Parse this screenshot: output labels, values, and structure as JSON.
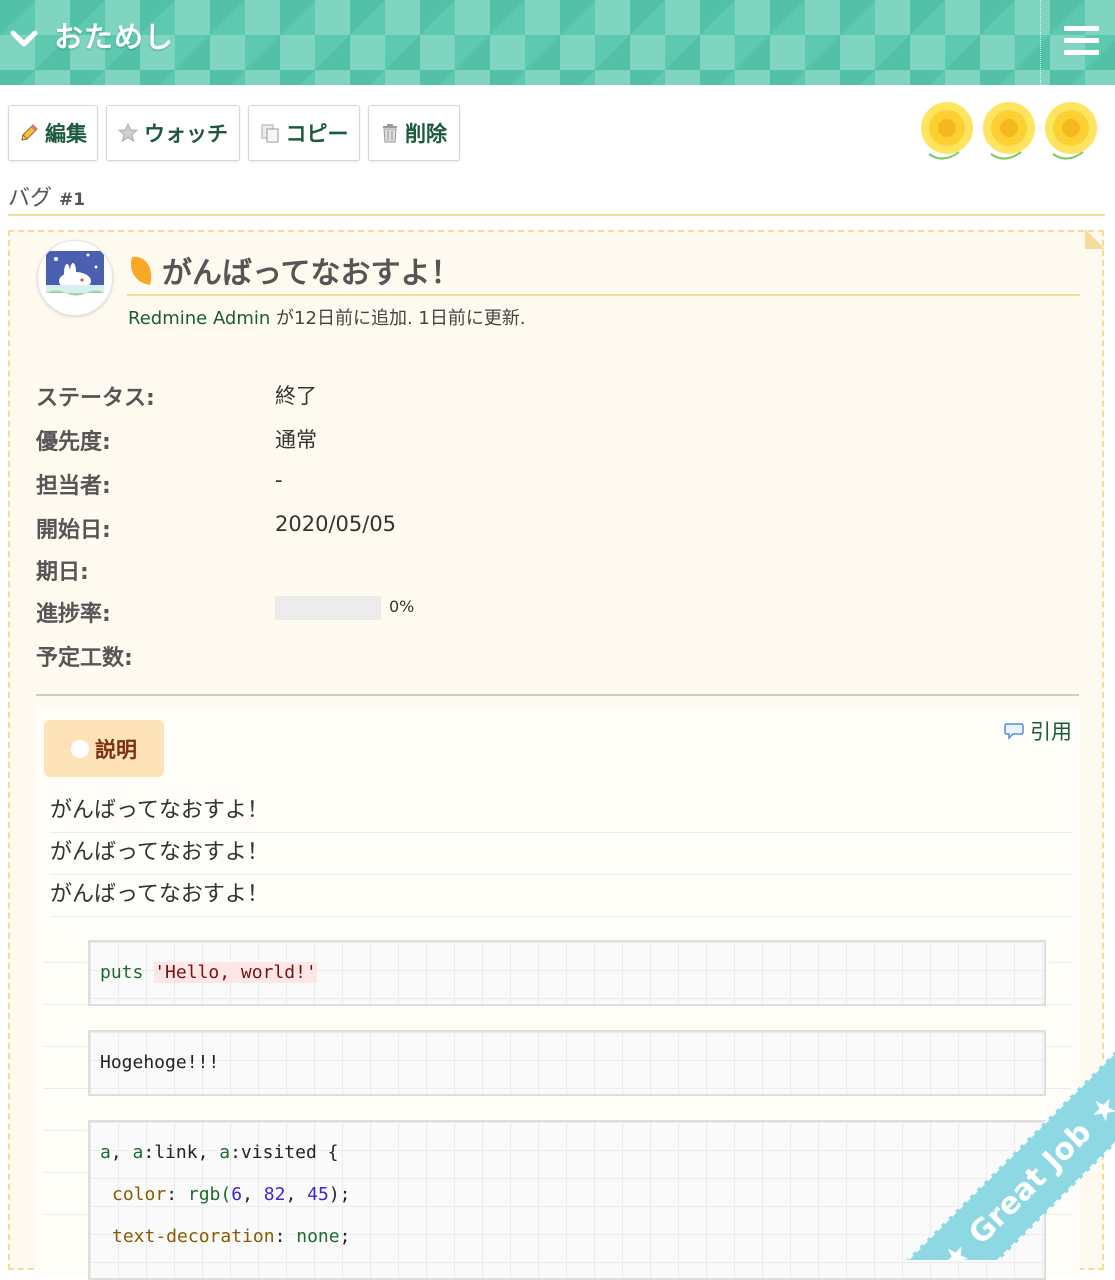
{
  "header": {
    "project_title": "おためし"
  },
  "toolbar": {
    "edit_label": "編集",
    "watch_label": "ウォッチ",
    "copy_label": "コピー",
    "delete_label": "削除"
  },
  "issue": {
    "tracker": "バグ",
    "number": "#1",
    "subject": "がんばってなおすよ！",
    "author_link": "Redmine Admin",
    "author_suffix": " が12日前に追加. 1日前に更新.",
    "attributes": {
      "status_label": "ステータス:",
      "status_value": "終了",
      "priority_label": "優先度:",
      "priority_value": "通常",
      "assignee_label": "担当者:",
      "assignee_value": "-",
      "start_label": "開始日:",
      "start_value": "2020/05/05",
      "due_label": "期日:",
      "progress_label": "進捗率:",
      "progress_percent": 0,
      "progress_text": "0%",
      "estimate_label": "予定工数:"
    },
    "description": {
      "heading": "説明",
      "quote_label": "引用",
      "lines": [
        "がんばってなおすよ！",
        "がんばってなおすよ！",
        "がんばってなおすよ！"
      ],
      "code1": {
        "keyword": "puts",
        "string": "'Hello, world!'"
      },
      "code2": "Hogehoge!!!",
      "code3": {
        "line1_sel_a": "a",
        "line1_sep1": ", ",
        "line1_sel_b": "a",
        "line1_pseudo_b": ":link",
        "line1_sep2": ", ",
        "line1_sel_c": "a",
        "line1_pseudo_c": ":visited {",
        "line2_prop": "color",
        "line2_colon": ": ",
        "line2_func": "rgb(",
        "line2_n1": "6",
        "line2_c1": ", ",
        "line2_n2": "82",
        "line2_c2": ", ",
        "line2_n3": "45",
        "line2_end": ");",
        "line3_prop": "text-decoration",
        "line3_colon": ": ",
        "line3_val": "none",
        "line3_end": ";"
      }
    }
  },
  "ribbon": {
    "text": "Great Job"
  },
  "colors": {
    "header": "#5cc9b0",
    "accent_green": "#1c5a3e",
    "issue_bg": "#fffaf0",
    "tag_bg": "#ffe3b8",
    "ribbon": "#8dd8e2"
  }
}
